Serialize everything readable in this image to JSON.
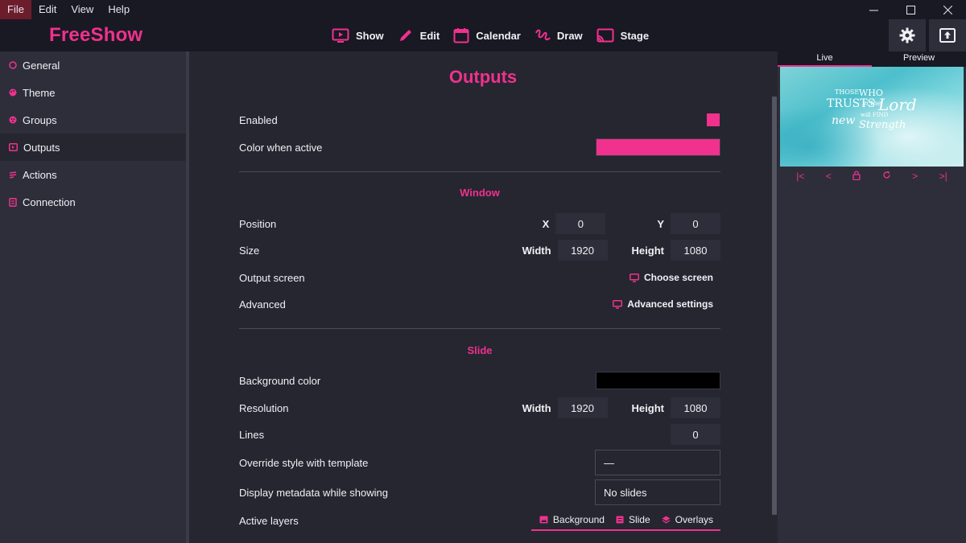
{
  "menu": {
    "items": [
      "File",
      "Edit",
      "View",
      "Help"
    ]
  },
  "app": {
    "brand": "FreeShow"
  },
  "nav": {
    "items": [
      {
        "label": "Show",
        "icon": "screen-icon"
      },
      {
        "label": "Edit",
        "icon": "pencil-icon"
      },
      {
        "label": "Calendar",
        "icon": "calendar-icon"
      },
      {
        "label": "Draw",
        "icon": "draw-icon"
      },
      {
        "label": "Stage",
        "icon": "cast-icon"
      }
    ]
  },
  "sidebar": {
    "items": [
      {
        "label": "General",
        "icon": "circle-icon"
      },
      {
        "label": "Theme",
        "icon": "palette-icon"
      },
      {
        "label": "Groups",
        "icon": "groups-icon"
      },
      {
        "label": "Outputs",
        "icon": "output-icon"
      },
      {
        "label": "Actions",
        "icon": "actions-icon"
      },
      {
        "label": "Connection",
        "icon": "connection-icon"
      }
    ],
    "active": "Outputs"
  },
  "main": {
    "title": "Outputs",
    "enabled_label": "Enabled",
    "color_active_label": "Color when active",
    "window_title": "Window",
    "position_label": "Position",
    "x_label": "X",
    "x_value": "0",
    "y_label": "Y",
    "y_value": "0",
    "size_label": "Size",
    "width_label": "Width",
    "width_value": "1920",
    "height_label": "Height",
    "height_value": "1080",
    "output_screen_label": "Output screen",
    "choose_screen": "Choose screen",
    "advanced_label": "Advanced",
    "advanced_settings": "Advanced settings",
    "slide_title": "Slide",
    "bg_color_label": "Background color",
    "resolution_label": "Resolution",
    "res_width_label": "Width",
    "res_width_value": "1920",
    "res_height_label": "Height",
    "res_height_value": "1080",
    "lines_label": "Lines",
    "lines_value": "0",
    "override_label": "Override style with template",
    "override_value": "—",
    "metadata_label": "Display metadata while showing",
    "metadata_value": "No slides",
    "layers_label": "Active layers",
    "layers": [
      "Background",
      "Slide",
      "Overlays"
    ]
  },
  "right": {
    "tabs": [
      "Live",
      "Preview"
    ],
    "preview_text": {
      "l1a": "THOSE",
      "l1b": "WHO",
      "l2a": "TRUSTS",
      "l2b": "in the",
      "l2c": "Lord",
      "l3a": "will FIND",
      "l4a": "new",
      "l4b": "Strength"
    }
  },
  "colors": {
    "accent": "#f0318e",
    "bg": "#25262f",
    "panel": "#2d2e3a",
    "bar": "#191923"
  }
}
